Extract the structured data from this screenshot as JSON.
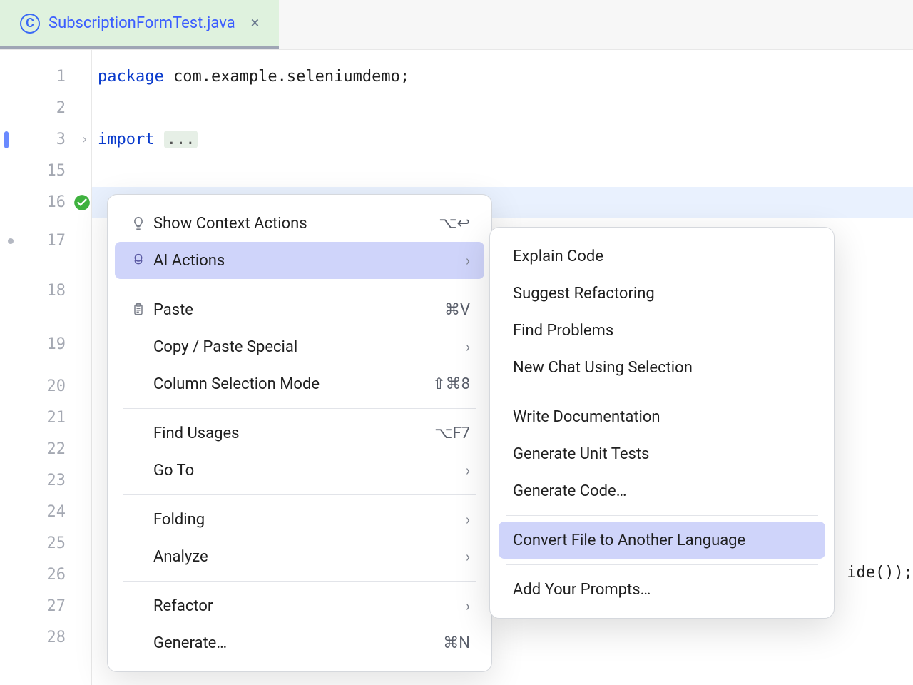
{
  "tab": {
    "title": "SubscriptionFormTest.java",
    "icon_letter": "C"
  },
  "gutter_lines": [
    "1",
    "2",
    "3",
    "15",
    "16",
    "17",
    "18",
    "19",
    "20",
    "21",
    "22",
    "23",
    "24",
    "25",
    "26",
    "27",
    "28"
  ],
  "code": {
    "l1_kw": "package",
    "l1_rest": " com.example.seleniumdemo;",
    "l3_kw": "import",
    "l3_dots": "...",
    "trail": "ide());"
  },
  "menu": {
    "show_context_actions": "Show Context Actions",
    "show_context_actions_sc": "⌥↩",
    "ai_actions": "AI Actions",
    "paste": "Paste",
    "paste_sc": "⌘V",
    "copy_paste_special": "Copy / Paste Special",
    "column_selection": "Column Selection Mode",
    "column_selection_sc": "⇧⌘8",
    "find_usages": "Find Usages",
    "find_usages_sc": "⌥F7",
    "goto": "Go To",
    "folding": "Folding",
    "analyze": "Analyze",
    "refactor": "Refactor",
    "generate": "Generate…",
    "generate_sc": "⌘N"
  },
  "submenu": {
    "explain": "Explain Code",
    "refactor": "Suggest Refactoring",
    "find_problems": "Find Problems",
    "new_chat": "New Chat Using Selection",
    "write_docs": "Write Documentation",
    "gen_tests": "Generate Unit Tests",
    "gen_code": "Generate Code…",
    "convert": "Convert File to Another Language",
    "add_prompts": "Add Your Prompts…"
  }
}
